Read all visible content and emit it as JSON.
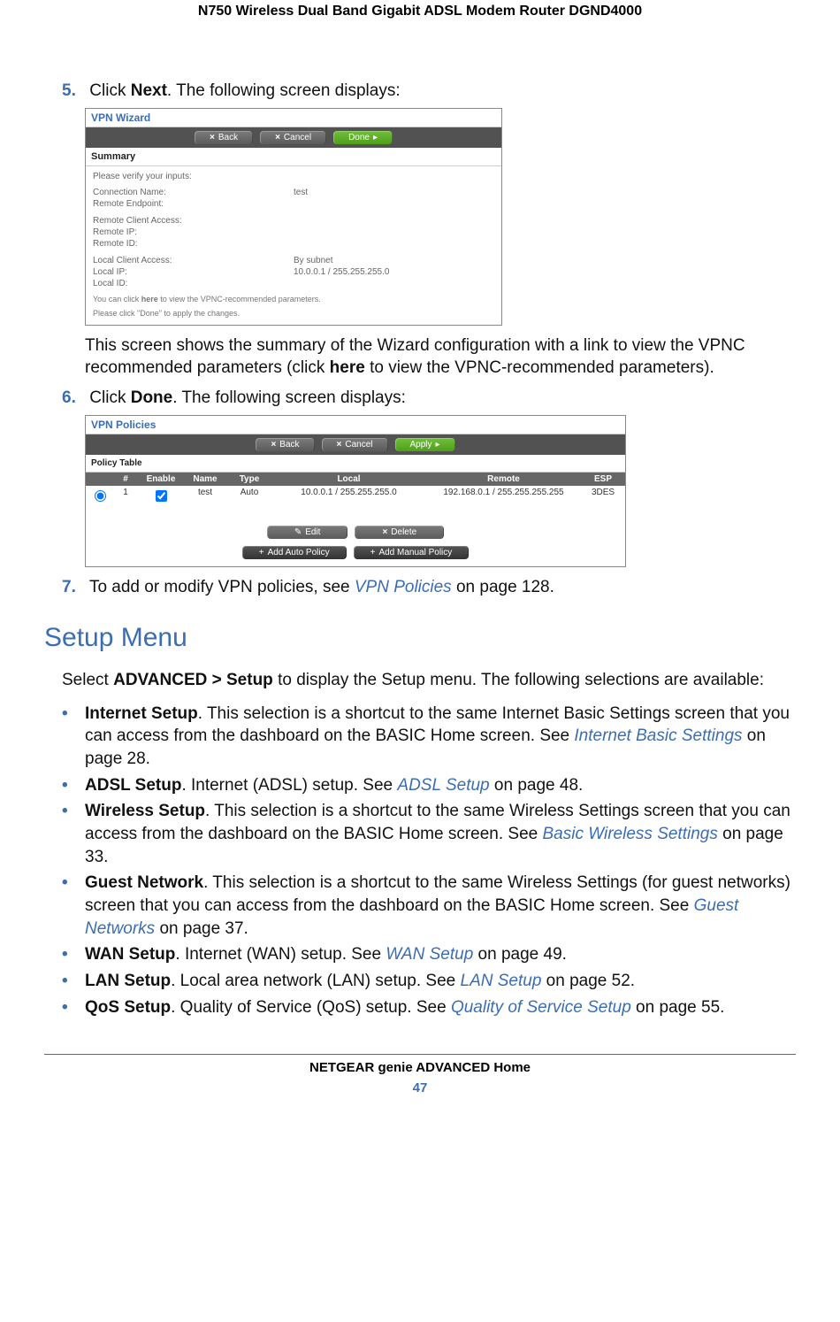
{
  "header": {
    "title": "N750 Wireless Dual Band Gigabit ADSL Modem Router DGND4000"
  },
  "steps": {
    "s5": {
      "num": "5.",
      "pre": "Click ",
      "bold": "Next",
      "post": ". The following screen displays:"
    },
    "s5_body": {
      "pre": "This screen shows the summary of the Wizard configuration with a link to view the VPNC recommended parameters (click ",
      "bold": "here",
      "post": " to view the VPNC-recommended parameters)."
    },
    "s6": {
      "num": "6.",
      "pre": "Click ",
      "bold": "Done",
      "post": ". The following screen displays:"
    },
    "s7": {
      "num": "7.",
      "pre": "To add or modify VPN policies, see ",
      "link": "VPN Policies",
      "post": " on page 128."
    }
  },
  "screenshot1": {
    "title": "VPN Wizard",
    "buttons": {
      "back": "Back",
      "cancel": "Cancel",
      "done": "Done"
    },
    "subhead": "Summary",
    "verify": "Please verify your inputs:",
    "rows": {
      "conn_name_l": "Connection Name:",
      "conn_name_v": "test",
      "rem_end_l": "Remote Endpoint:",
      "rca_l": "Remote Client Access:",
      "rip_l": "Remote IP:",
      "rid_l": "Remote ID:",
      "lca_l": "Local Client Access:",
      "lca_v": "By subnet",
      "lip_l": "Local IP:",
      "lip_v": "10.0.0.1 / 255.255.255.0",
      "lid_l": "Local ID:"
    },
    "note1_pre": "You can click ",
    "note1_bold": "here",
    "note1_post": "to view the VPNC-recommended parameters.",
    "note2": "Please click \"Done\" to apply the changes."
  },
  "screenshot2": {
    "title": "VPN Policies",
    "buttons": {
      "back": "Back",
      "cancel": "Cancel",
      "apply": "Apply",
      "edit": "Edit",
      "delete": "Delete",
      "add_auto": "Add Auto Policy",
      "add_manual": "Add Manual Policy"
    },
    "tablehead": "Policy Table",
    "cols": {
      "num": "#",
      "enable": "Enable",
      "name": "Name",
      "type": "Type",
      "local": "Local",
      "remote": "Remote",
      "esp": "ESP"
    },
    "row": {
      "num": "1",
      "name": "test",
      "type": "Auto",
      "local": "10.0.0.1 / 255.255.255.0",
      "remote": "192.168.0.1 / 255.255.255.255",
      "esp": "3DES"
    }
  },
  "setup_menu": {
    "title": "Setup Menu",
    "intro_pre": "Select ",
    "intro_bold": "ADVANCED > Setup",
    "intro_post": " to display the Setup menu. The following selections are available:",
    "items": [
      {
        "bold": "Internet Setup",
        "after": ". This selection is a shortcut to the same Internet Basic Settings screen that you can access from the dashboard on the BASIC Home screen. See ",
        "link": "Internet Basic Settings",
        "tail": " on page 28."
      },
      {
        "bold": "ADSL Setup",
        "after": ". Internet (ADSL) setup. See ",
        "link": "ADSL Setup",
        "tail": " on page 48."
      },
      {
        "bold": "Wireless Setup",
        "after": ". This selection is a shortcut to the same Wireless Settings screen that you can access from the dashboard on the BASIC Home screen. See ",
        "link": "Basic Wireless Settings",
        "tail": " on page 33."
      },
      {
        "bold": "Guest Network",
        "after": ". This selection is a shortcut to the same Wireless Settings (for guest networks) screen that you can access from the dashboard on the BASIC Home screen. See ",
        "link": "Guest Networks",
        "tail": " on page 37."
      },
      {
        "bold": "WAN Setup",
        "after": ". Internet (WAN) setup. See ",
        "link": "WAN Setup",
        "tail": " on page 49."
      },
      {
        "bold": "LAN Setup",
        "after": ". Local area network (LAN) setup. See ",
        "link": "LAN Setup",
        "tail": " on page 52."
      },
      {
        "bold": "QoS Setup",
        "after": ". Quality of Service (QoS) setup. See ",
        "link": "Quality of Service Setup",
        "tail": " on page 55."
      }
    ]
  },
  "footer": {
    "title": "NETGEAR genie ADVANCED Home",
    "page": "47"
  }
}
